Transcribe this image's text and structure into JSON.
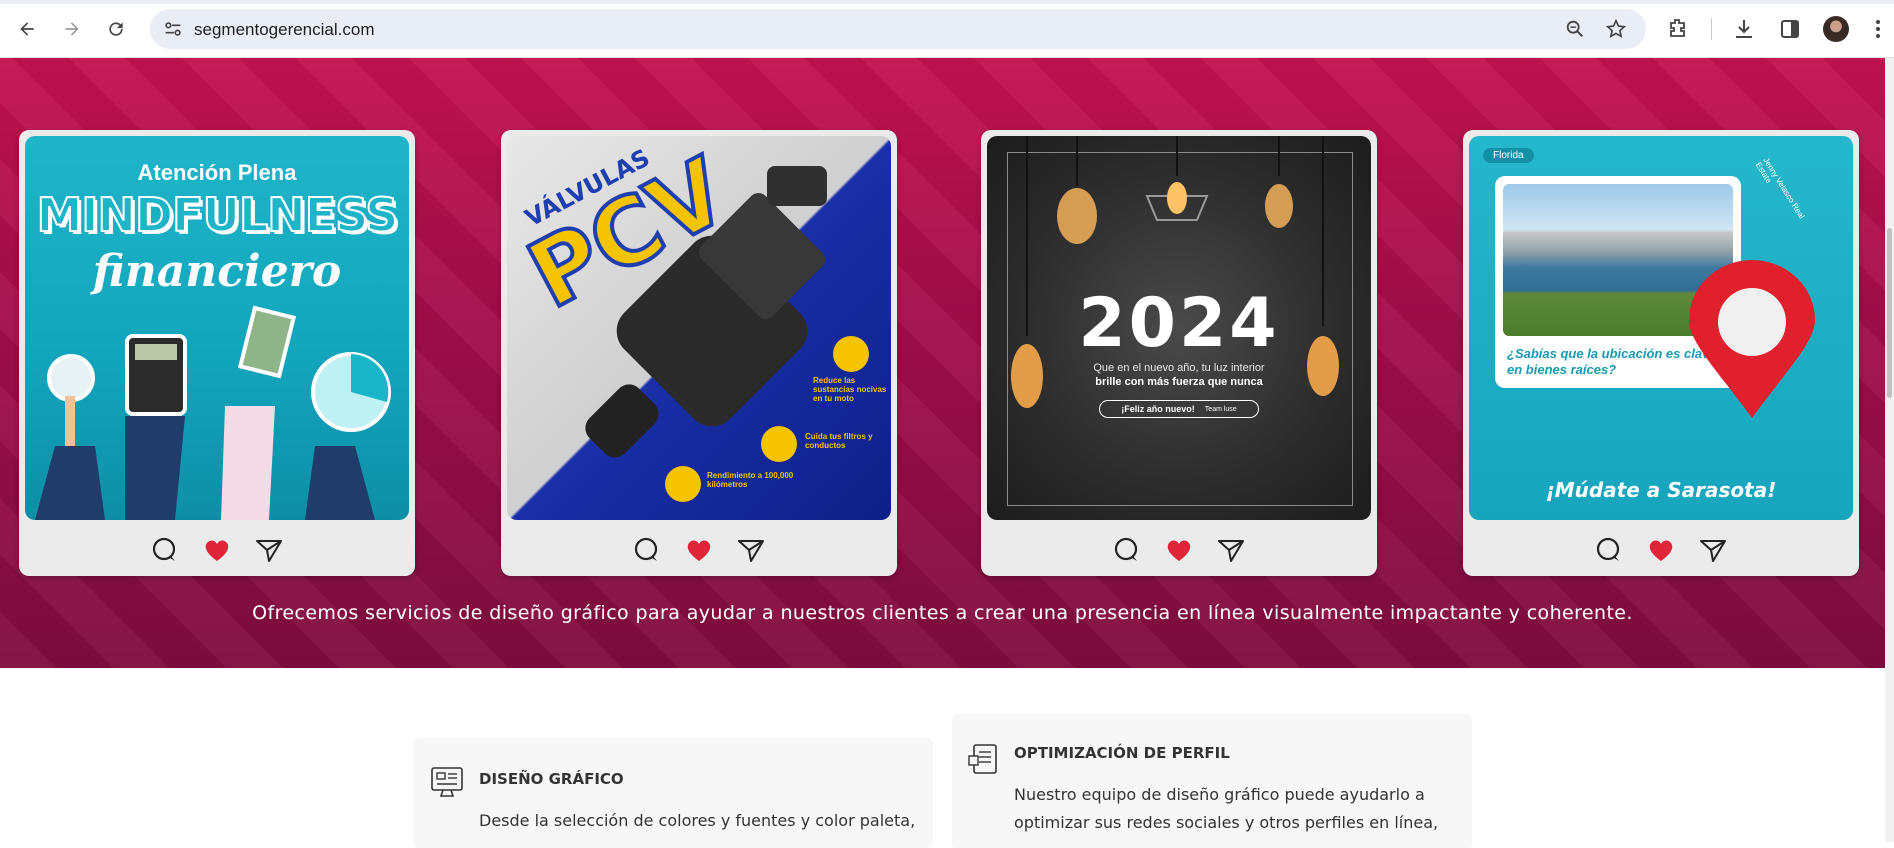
{
  "browser": {
    "url": "segmentogerencial.com",
    "icons": [
      "back-icon",
      "forward-icon",
      "reload-icon",
      "site-settings-icon",
      "zoom-icon",
      "star-icon",
      "extensions-icon",
      "downloads-icon",
      "side-panel-icon",
      "profile-avatar",
      "menu-icon"
    ]
  },
  "posts": [
    {
      "kicker": "Atención Plena",
      "title": "MINDFULNESS",
      "subtitle": "financiero"
    },
    {
      "kicker": "VÁLVULAS",
      "title": "PCV",
      "features": [
        "Reduce las sustancias nocivas en tu moto",
        "Cuida tus filtros y conductos",
        "Rendimiento a 100,000 kilómetros"
      ]
    },
    {
      "title": "2024",
      "line1": "Que en el nuevo año, tu luz interior",
      "line2": "brille con más fuerza que nunca",
      "pill_main": "¡Feliz año nuevo!",
      "pill_sig": "Team luse"
    },
    {
      "tag": "Florida",
      "brand": "Jenny Velasco Real Estate",
      "question": "¿Sabías que la ubicación es clave en bienes raíces?",
      "cta": "¡Múdate a Sarasota!"
    }
  ],
  "tagline": "Ofrecemos servicios de diseño gráfico para ayudar a nuestros clientes a crear una presencia en línea visualmente impactante y coherente.",
  "services": [
    {
      "title": "DISEÑO GRÁFICO",
      "text": "Desde la selección de colores y fuentes y color paleta,"
    },
    {
      "title": "OPTIMIZACIÓN DE PERFIL",
      "text_line1": "Nuestro equipo de diseño gráfico puede ayudarlo a",
      "text_line2": "optimizar sus redes sociales y otros perfiles en línea,"
    }
  ],
  "colors": {
    "hero": "#b0104b",
    "accent_teal": "#1fb5c9",
    "accent_yellow": "#f4c400",
    "heart": "#e0243a"
  }
}
